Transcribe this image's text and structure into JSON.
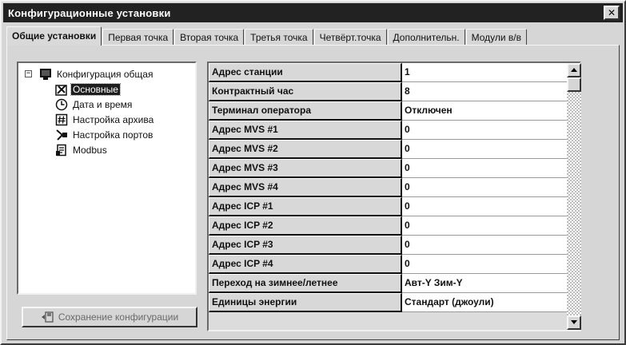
{
  "window": {
    "title": "Конфигурационные установки",
    "close_glyph": "✕"
  },
  "tabs": [
    {
      "label": "Общие установки",
      "active": true
    },
    {
      "label": "Первая точка"
    },
    {
      "label": "Вторая точка"
    },
    {
      "label": "Третья точка"
    },
    {
      "label": "Четвёрт.точка"
    },
    {
      "label": "Дополнительн."
    },
    {
      "label": "Модули в/в"
    }
  ],
  "tree": {
    "root": {
      "label": "Конфигурация общая",
      "icon": "monitor-icon",
      "expander": "−"
    },
    "items": [
      {
        "label": "Основные",
        "icon": "tools-icon",
        "selected": true
      },
      {
        "label": "Дата и время",
        "icon": "clock-icon"
      },
      {
        "label": "Настройка архива",
        "icon": "hash-icon"
      },
      {
        "label": "Настройка портов",
        "icon": "plug-icon"
      },
      {
        "label": "Modbus",
        "icon": "document-icon"
      }
    ]
  },
  "save_button": {
    "label": "Сохранение конфигурации",
    "icon": "save-icon"
  },
  "properties": [
    {
      "name": "Адрес станции",
      "value": "1"
    },
    {
      "name": "Контрактный час",
      "value": "8"
    },
    {
      "name": "Терминал оператора",
      "value": "Отключен"
    },
    {
      "name": "Адрес MVS #1",
      "value": "0"
    },
    {
      "name": "Адрес MVS #2",
      "value": "0"
    },
    {
      "name": "Адрес MVS #3",
      "value": "0"
    },
    {
      "name": "Адрес MVS #4",
      "value": "0"
    },
    {
      "name": "Адрес ICP #1",
      "value": "0"
    },
    {
      "name": "Адрес ICP #2",
      "value": "0"
    },
    {
      "name": "Адрес ICP #3",
      "value": "0"
    },
    {
      "name": "Адрес ICP #4",
      "value": "0"
    },
    {
      "name": "Переход на зимнее/летнее",
      "value": "Авт-Y Зим-Y"
    },
    {
      "name": "Единицы энергии",
      "value": "Стандарт (джоули)"
    }
  ],
  "colors": {
    "titlebar": "#222222",
    "face": "#d6d6d6",
    "selection": "#1e1e1e"
  }
}
